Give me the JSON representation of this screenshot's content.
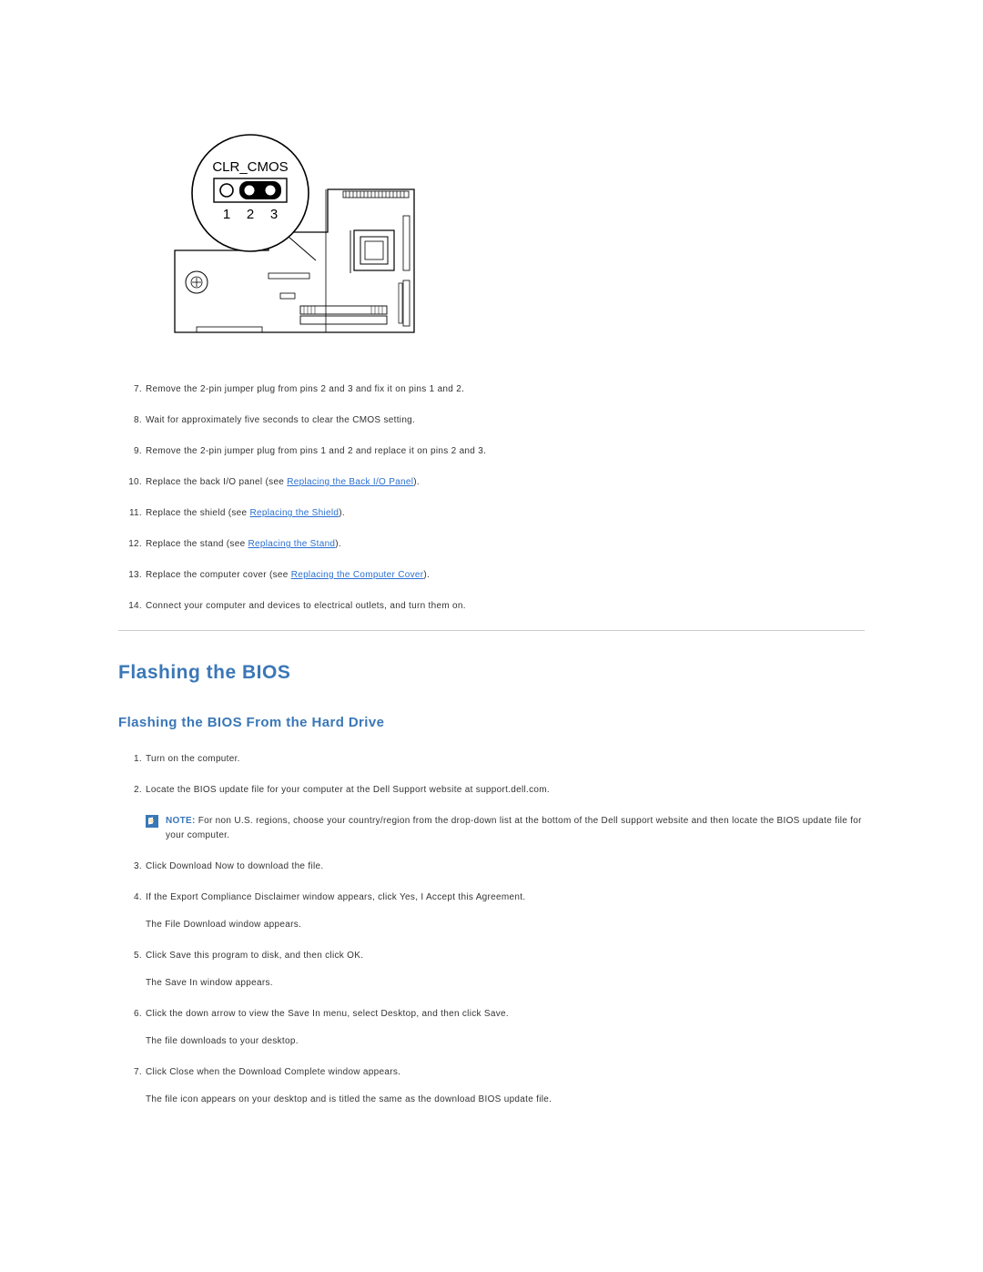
{
  "diagram": {
    "callout_label": "CLR_CMOS",
    "pin_labels": [
      "1",
      "2",
      "3"
    ]
  },
  "steps_a": [
    {
      "n": "7.",
      "text": "Remove the 2-pin jumper plug from pins 2 and 3 and fix it on pins 1 and 2."
    },
    {
      "n": "8.",
      "text": "Wait for approximately five seconds to clear the CMOS setting."
    },
    {
      "n": "9.",
      "text": "Remove the 2-pin jumper plug from pins 1 and 2 and replace it on pins 2 and 3."
    },
    {
      "n": "10.",
      "pre": "Replace the back I/O panel (see ",
      "link": "Replacing the Back I/O Panel",
      "post": ")."
    },
    {
      "n": "11.",
      "pre": "Replace the shield (see ",
      "link": "Replacing the Shield",
      "post": ")."
    },
    {
      "n": "12.",
      "pre": "Replace the stand (see ",
      "link": "Replacing the Stand",
      "post": ")."
    },
    {
      "n": "13.",
      "pre": "Replace the computer cover (see ",
      "link": "Replacing the Computer Cover",
      "post": ")."
    },
    {
      "n": "14.",
      "text": "Connect your computer and devices to electrical outlets, and turn them on."
    }
  ],
  "section_title": "Flashing the BIOS",
  "subsection_title": "Flashing the BIOS From the Hard Drive",
  "note_label": "NOTE:",
  "note_text": "For non U.S. regions, choose your country/region from the drop-down list at the bottom of the Dell support website and then locate the BIOS update file for your computer.",
  "steps_b": [
    {
      "n": "1.",
      "text": "Turn on the computer."
    },
    {
      "n": "2.",
      "text": "Locate the BIOS update file for your computer at the Dell Support website at support.dell.com."
    },
    {
      "n": "3.",
      "text": "Click Download Now to download the file."
    },
    {
      "n": "4.",
      "text": "If the Export Compliance Disclaimer window appears, click Yes, I Accept this Agreement.",
      "sub": "The File Download window appears."
    },
    {
      "n": "5.",
      "text": "Click Save this program to disk, and then click OK.",
      "sub": "The Save In window appears."
    },
    {
      "n": "6.",
      "text": "Click the down arrow to view the Save In menu, select Desktop, and then click Save.",
      "sub": "The file downloads to your desktop."
    },
    {
      "n": "7.",
      "text": "Click Close when the Download Complete window appears.",
      "sub": "The file icon appears on your desktop and is titled the same as the download BIOS update file."
    }
  ]
}
